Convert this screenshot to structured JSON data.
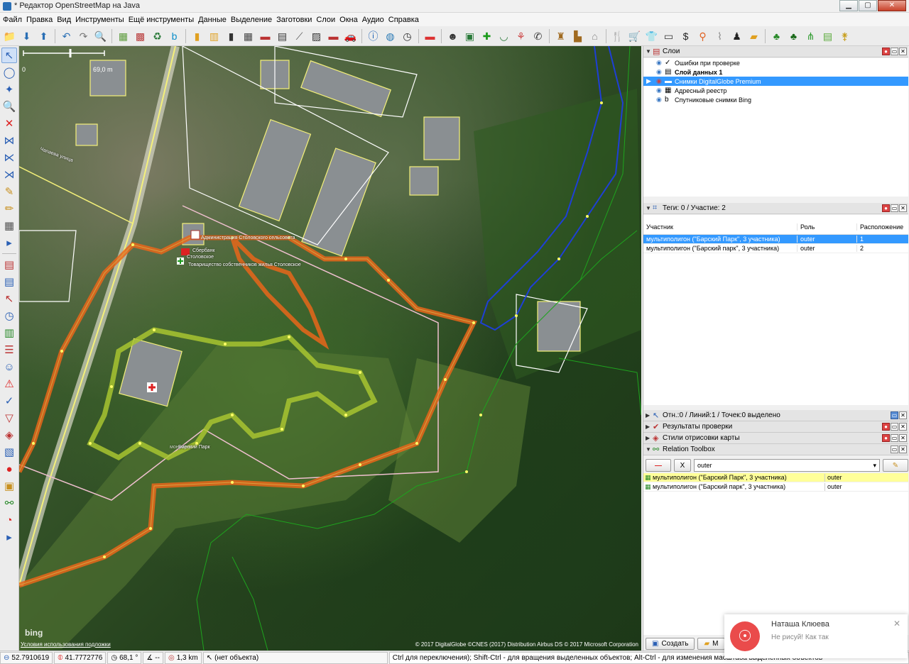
{
  "window": {
    "title": "* Редактор OpenStreetMap на Java",
    "buttons": {
      "minimize": "▁",
      "maximize": "▢",
      "close": "✕"
    }
  },
  "menu": [
    "Файл",
    "Правка",
    "Вид",
    "Инструменты",
    "Ещё инструменты",
    "Данные",
    "Выделение",
    "Заготовки",
    "Слои",
    "Окна",
    "Аудио",
    "Справка"
  ],
  "toolbar": [
    {
      "icon": "folder-icon",
      "glyph": "📁",
      "color": "#2a6fb5"
    },
    {
      "icon": "download-icon",
      "glyph": "⬇",
      "color": "#2a6fb5"
    },
    {
      "icon": "upload-icon",
      "glyph": "⬆",
      "color": "#2a6fb5"
    },
    {
      "sep": true
    },
    {
      "icon": "undo-icon",
      "glyph": "↶",
      "color": "#2a6fb5"
    },
    {
      "icon": "redo-icon",
      "glyph": "↷",
      "color": "#777"
    },
    {
      "icon": "zoom-icon",
      "glyph": "🔍",
      "color": "#333"
    },
    {
      "sep": true
    },
    {
      "icon": "layer-icon",
      "glyph": "▦",
      "color": "#5a9a3a"
    },
    {
      "icon": "imagery-icon",
      "glyph": "▩",
      "color": "#b83a3a"
    },
    {
      "icon": "recycle-icon",
      "glyph": "♻",
      "color": "#2a7a3a"
    },
    {
      "icon": "bing-icon",
      "glyph": "b",
      "color": "#0a8ec9"
    },
    {
      "sep": true
    },
    {
      "icon": "traffic-light-icon",
      "glyph": "▮",
      "color": "#e0a020"
    },
    {
      "icon": "bus-icon",
      "glyph": "▥",
      "color": "#e0a020"
    },
    {
      "icon": "crossing-icon",
      "glyph": "▮",
      "color": "#333"
    },
    {
      "icon": "building-icon",
      "glyph": "▦",
      "color": "#444"
    },
    {
      "icon": "wall-icon",
      "glyph": "▬",
      "color": "#b33"
    },
    {
      "icon": "bridge-icon",
      "glyph": "▤",
      "color": "#333"
    },
    {
      "icon": "railway-icon",
      "glyph": "⟋",
      "color": "#555"
    },
    {
      "icon": "hatch-icon",
      "glyph": "▨",
      "color": "#333"
    },
    {
      "icon": "brick-icon",
      "glyph": "▬",
      "color": "#b33"
    },
    {
      "icon": "car-icon",
      "glyph": "🚗",
      "color": "#333"
    },
    {
      "sep": true
    },
    {
      "icon": "info-icon",
      "glyph": "ⓘ",
      "color": "#1a5fb4"
    },
    {
      "icon": "globe-icon",
      "glyph": "◍",
      "color": "#2a7ab5"
    },
    {
      "icon": "clock-icon",
      "glyph": "◷",
      "color": "#333"
    },
    {
      "sep": true
    },
    {
      "icon": "flag-icon",
      "glyph": "▬",
      "color": "#d33"
    },
    {
      "sep": true
    },
    {
      "icon": "mask-icon",
      "glyph": "☻",
      "color": "#333"
    },
    {
      "icon": "picture-icon",
      "glyph": "▣",
      "color": "#2a7a3a"
    },
    {
      "icon": "plus-icon",
      "glyph": "✚",
      "color": "#1a9a1a"
    },
    {
      "icon": "bowl-icon",
      "glyph": "◡",
      "color": "#2a7a3a"
    },
    {
      "icon": "balloons-icon",
      "glyph": "⚘",
      "color": "#c44"
    },
    {
      "icon": "phone-icon",
      "glyph": "✆",
      "color": "#333"
    },
    {
      "sep": true
    },
    {
      "icon": "castle-icon",
      "glyph": "♜",
      "color": "#a06a20"
    },
    {
      "icon": "factory-icon",
      "glyph": "▙",
      "color": "#a06a20"
    },
    {
      "icon": "house-icon",
      "glyph": "⌂",
      "color": "#888"
    },
    {
      "sep": true
    },
    {
      "icon": "fork-knife-icon",
      "glyph": "🍴",
      "color": "#333"
    },
    {
      "icon": "cart-icon",
      "glyph": "🛒",
      "color": "#8a3ab8"
    },
    {
      "icon": "shirt-icon",
      "glyph": "👕",
      "color": "#1a5fb4"
    },
    {
      "icon": "tv-icon",
      "glyph": "▭",
      "color": "#333"
    },
    {
      "icon": "dollar-icon",
      "glyph": "$",
      "color": "#222"
    },
    {
      "icon": "pin-icon",
      "glyph": "⚲",
      "color": "#e06020"
    },
    {
      "icon": "paperclip-icon",
      "glyph": "⌇",
      "color": "#888"
    },
    {
      "icon": "person-icon",
      "glyph": "♟",
      "color": "#222"
    },
    {
      "icon": "bag-icon",
      "glyph": "▰",
      "color": "#e0a020"
    },
    {
      "sep": true
    },
    {
      "icon": "tree-icon",
      "glyph": "♣",
      "color": "#2a8a2a"
    },
    {
      "icon": "forest-icon",
      "glyph": "♣",
      "color": "#1a6a1a"
    },
    {
      "icon": "grass-icon",
      "glyph": "⋔",
      "color": "#2a9a2a"
    },
    {
      "icon": "field-icon",
      "glyph": "▤",
      "color": "#5aaa3a"
    },
    {
      "icon": "wheat-icon",
      "glyph": "⚵",
      "color": "#c8a020"
    }
  ],
  "left_tools": [
    {
      "icon": "select-arrow-icon",
      "glyph": "↖",
      "color": "#2a5fb4",
      "active": true
    },
    {
      "icon": "lasso-icon",
      "glyph": "◯",
      "color": "#2a5fb4"
    },
    {
      "icon": "draw-node-icon",
      "glyph": "✦",
      "color": "#2a5fb4"
    },
    {
      "icon": "zoom-tool-icon",
      "glyph": "🔍",
      "color": "#2a5fb4"
    },
    {
      "icon": "delete-icon",
      "glyph": "✕",
      "color": "#d22"
    },
    {
      "icon": "split-icon",
      "glyph": "⋈",
      "color": "#2a5fb4"
    },
    {
      "icon": "combine-icon",
      "glyph": "⋉",
      "color": "#2a5fb4"
    },
    {
      "icon": "parallel-icon",
      "glyph": "⋊",
      "color": "#2a5fb4"
    },
    {
      "icon": "draw-icon",
      "glyph": "✎",
      "color": "#c89020"
    },
    {
      "icon": "pencil-icon",
      "glyph": "✏",
      "color": "#c89020"
    },
    {
      "icon": "building-tool-icon",
      "glyph": "▦",
      "color": "#555"
    },
    {
      "icon": "more-icon",
      "glyph": "▸",
      "color": "#2a5fb4"
    },
    {
      "sep": true
    },
    {
      "icon": "layers-panel-icon",
      "glyph": "▤",
      "color": "#b33"
    },
    {
      "icon": "select-panel-icon",
      "glyph": "▤",
      "color": "#2a5fb4"
    },
    {
      "icon": "cursor-panel-icon",
      "glyph": "↖",
      "color": "#b33"
    },
    {
      "icon": "history-icon",
      "glyph": "◷",
      "color": "#2a5fb4"
    },
    {
      "icon": "chart-icon",
      "glyph": "▥",
      "color": "#2a8a2a"
    },
    {
      "icon": "list-icon",
      "glyph": "☰",
      "color": "#b33"
    },
    {
      "icon": "user-icon",
      "glyph": "☺",
      "color": "#2a5fb4"
    },
    {
      "icon": "warning-icon",
      "glyph": "⚠",
      "color": "#d22"
    },
    {
      "icon": "check-icon",
      "glyph": "✓",
      "color": "#2a5fb4"
    },
    {
      "icon": "filter-icon",
      "glyph": "▽",
      "color": "#b33"
    },
    {
      "icon": "map-style-icon",
      "glyph": "◈",
      "color": "#b33"
    },
    {
      "icon": "paint-icon",
      "glyph": "▧",
      "color": "#2a5fb4"
    },
    {
      "icon": "marker-icon",
      "glyph": "●",
      "color": "#d22"
    },
    {
      "icon": "image-tool-icon",
      "glyph": "▣",
      "color": "#c89020"
    },
    {
      "icon": "relation-icon",
      "glyph": "⚯",
      "color": "#2a8a2a"
    },
    {
      "icon": "speed-icon",
      "glyph": "◔",
      "color": "#d22"
    },
    {
      "icon": "forward-icon",
      "glyph": "▸",
      "color": "#2a5fb4"
    }
  ],
  "map": {
    "scale_zero": "0",
    "scale_label": "69,0 m",
    "street_label": "Чапаева улица",
    "label_admin": "Администрация Столовского сельсовета",
    "label_bank": "Сбербанк",
    "label_stolovskoe": "Столовское",
    "label_tsj": "Товарищество собственников жилья Столовское",
    "label_park": "Барский Парк",
    "label_monument": "монумент",
    "bing": "bing",
    "terms": "Условия использования подложки",
    "attribution": "© 2017 DigitalGlobe ©CNES (2017) Distribution Airbus DS © 2017 Microsoft Corporation"
  },
  "layers_panel": {
    "title": "Слои",
    "items": [
      {
        "label": "Ошибки при проверке",
        "icon": "✓",
        "active": false,
        "bold": false,
        "selected": false
      },
      {
        "label": "Слой данных 1",
        "icon": "▤",
        "active": false,
        "bold": true,
        "selected": false
      },
      {
        "label": "Снимки DigitalGlobe Premium",
        "icon": "▬",
        "active": true,
        "bold": false,
        "selected": true
      },
      {
        "label": "Адресный реестр",
        "icon": "▦",
        "active": false,
        "bold": false,
        "selected": false
      },
      {
        "label": "Спутниковые снимки Bing",
        "icon": "b",
        "active": false,
        "bold": false,
        "selected": false
      }
    ]
  },
  "tags_panel": {
    "title": "Теги: 0 / Участие: 2",
    "columns": [
      "Участник",
      "Роль",
      "Расположение"
    ],
    "rows": [
      {
        "member": "мультиполигон (\"Барский Парк\", 3 участника)",
        "role": "outer",
        "pos": "1",
        "selected": true
      },
      {
        "member": "мультиполигон (\"Барский парк\", 3 участника)",
        "role": "outer",
        "pos": "2",
        "selected": false
      }
    ]
  },
  "selection_panel": {
    "title": "Отн.:0 / Линий:1 / Точек:0 выделено"
  },
  "validation_panel": {
    "title": "Результаты проверки"
  },
  "styles_panel": {
    "title": "Стили отрисовки карты"
  },
  "relation_toolbox": {
    "title": "Relation Toolbox",
    "remove_label": "—",
    "x_label": "X",
    "role_value": "outer",
    "edit_label": "✎",
    "rows": [
      {
        "member": "мультиполигон (\"Барский Парк\", 3 участника)",
        "role": "outer",
        "highlight": true
      },
      {
        "member": "мультиполигон (\"Барский парк\", 3 участника)",
        "role": "outer",
        "highlight": false
      }
    ]
  },
  "bottom_buttons": {
    "create": "Создать",
    "second": "M"
  },
  "statusbar": {
    "lat": "52.7910619",
    "lon": "41.7772776",
    "heading": "68,1 °",
    "angle": "--",
    "distance": "1,3 km",
    "object": "(нет объекта)",
    "help": "Ctrl для переключения); Shift-Ctrl - для вращения выделенных объектов; Alt-Ctrl - для изменения масштаба выделенных объектов"
  },
  "notification": {
    "name": "Наташа Клюева",
    "message": "Не рисуй! Как так"
  },
  "colors": {
    "selected_row": "#3399ff",
    "highlight_row": "#ffff99",
    "park_outline": "#e8661a",
    "park_inner": "#a8c430",
    "river": "#1e3fd6",
    "forest_edge": "#1ea41e",
    "avatar": "#ea4b4b"
  }
}
